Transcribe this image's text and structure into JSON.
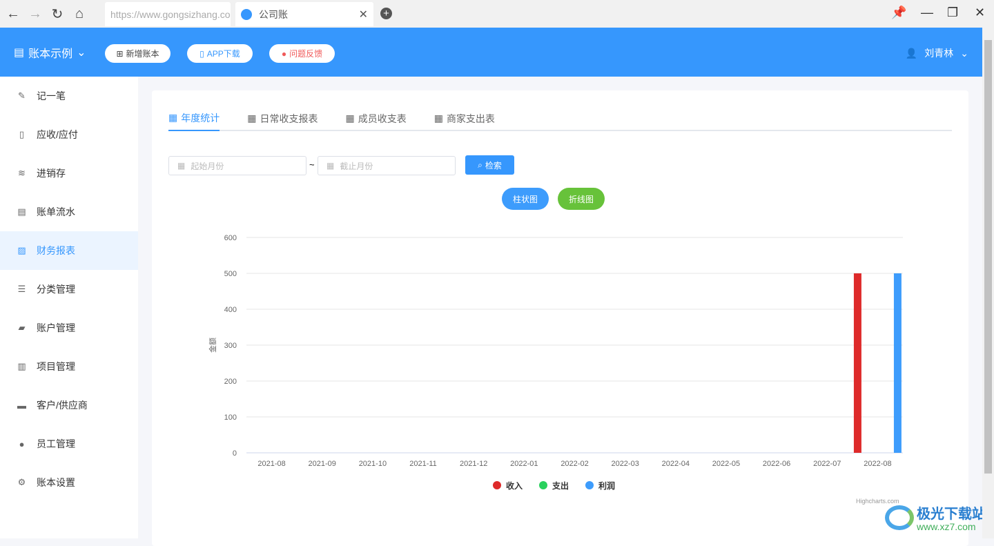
{
  "browser": {
    "url": "https://www.gongsizhang.com",
    "tab_title": "公司账"
  },
  "header": {
    "book_name": "账本示例",
    "buttons": [
      "新增账本",
      "APP下载",
      "问题反馈"
    ],
    "user": "刘青林",
    "color": "#3697fd"
  },
  "sidebar": {
    "items": [
      {
        "label": "记一笔",
        "icon": "pen-icon"
      },
      {
        "label": "应收/应付",
        "icon": "book-icon"
      },
      {
        "label": "进销存",
        "icon": "database-icon"
      },
      {
        "label": "账单流水",
        "icon": "clipboard-icon"
      },
      {
        "label": "财务报表",
        "icon": "chart-icon",
        "active": true
      },
      {
        "label": "分类管理",
        "icon": "sliders-icon"
      },
      {
        "label": "账户管理",
        "icon": "wallet-icon"
      },
      {
        "label": "项目管理",
        "icon": "project-icon"
      },
      {
        "label": "客户/供应商",
        "icon": "store-icon"
      },
      {
        "label": "员工管理",
        "icon": "user-icon"
      },
      {
        "label": "账本设置",
        "icon": "gear-icon"
      }
    ]
  },
  "tabs": [
    "年度统计",
    "日常收支报表",
    "成员收支表",
    "商家支出表"
  ],
  "filter": {
    "start_placeholder": "起始月份",
    "end_placeholder": "截止月份",
    "separator": "~",
    "search": "检索"
  },
  "chart_toggle": {
    "bar": "柱状图",
    "line": "折线图"
  },
  "credit": "Highcharts.com",
  "watermark": "极光下载站 www.xz7.com",
  "chart_data": {
    "type": "bar",
    "ylabel": "金额",
    "ylim": [
      0,
      600
    ],
    "yticks": [
      0,
      100,
      200,
      300,
      400,
      500,
      600
    ],
    "grid": true,
    "legend": "bottom",
    "categories": [
      "2021-08",
      "2021-09",
      "2021-10",
      "2021-11",
      "2021-12",
      "2022-01",
      "2022-02",
      "2022-03",
      "2022-04",
      "2022-05",
      "2022-06",
      "2022-07",
      "2022-08"
    ],
    "series": [
      {
        "name": "收入",
        "color": "#de2a2a",
        "values": [
          0,
          0,
          0,
          0,
          0,
          0,
          0,
          0,
          0,
          0,
          0,
          0,
          500
        ]
      },
      {
        "name": "支出",
        "color": "#29d15d",
        "values": [
          0,
          0,
          0,
          0,
          0,
          0,
          0,
          0,
          0,
          0,
          0,
          0,
          0
        ]
      },
      {
        "name": "利润",
        "color": "#3d9cfc",
        "values": [
          0,
          0,
          0,
          0,
          0,
          0,
          0,
          0,
          0,
          0,
          0,
          0,
          500
        ]
      }
    ]
  }
}
